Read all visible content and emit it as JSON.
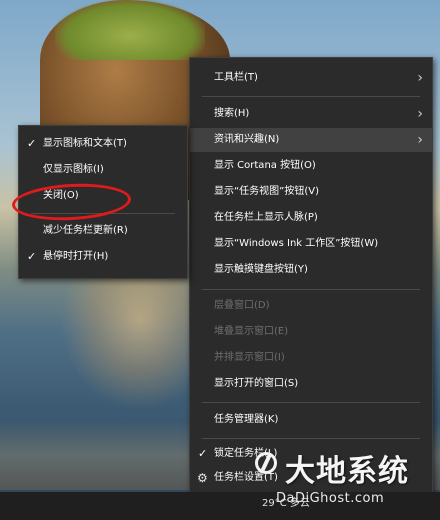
{
  "main_menu": {
    "items": [
      {
        "label": "工具栏(T)",
        "has_submenu": true
      },
      {
        "label": "搜索(H)",
        "has_submenu": true
      },
      {
        "label": "资讯和兴趣(N)",
        "has_submenu": true,
        "highlighted": true
      },
      {
        "label": "显示 Cortana 按钮(O)"
      },
      {
        "label": "显示“任务视图”按钮(V)"
      },
      {
        "label": "在任务栏上显示人脉(P)"
      },
      {
        "label": "显示“Windows Ink 工作区”按钮(W)"
      },
      {
        "label": "显示触摸键盘按钮(Y)"
      },
      {
        "label": "层叠窗口(D)",
        "disabled": true
      },
      {
        "label": "堆叠显示窗口(E)",
        "disabled": true
      },
      {
        "label": "并排显示窗口(I)",
        "disabled": true
      },
      {
        "label": "显示打开的窗口(S)"
      },
      {
        "label": "任务管理器(K)"
      },
      {
        "label": "锁定任务栏(L)",
        "checked": true
      },
      {
        "label": "任务栏设置(T)",
        "icon": "gear-icon"
      }
    ]
  },
  "sub_menu": {
    "items": [
      {
        "label": "显示图标和文本(T)",
        "checked": true
      },
      {
        "label": "仅显示图标(I)"
      },
      {
        "label": "关闭(O)",
        "annotated": true
      },
      {
        "label": "减少任务栏更新(R)"
      },
      {
        "label": "悬停时打开(H)",
        "checked": true
      }
    ]
  },
  "taskbar": {
    "tray_text": "29°C 多云"
  },
  "watermark": {
    "brand_cn": "大地系统",
    "brand_en": "DaDiGhost.com"
  },
  "colors": {
    "menu_bg": "#2b2b2b",
    "highlight_bg": "#414141",
    "disabled_text": "#6f6f6f",
    "annotation_red": "#e01b1b"
  }
}
